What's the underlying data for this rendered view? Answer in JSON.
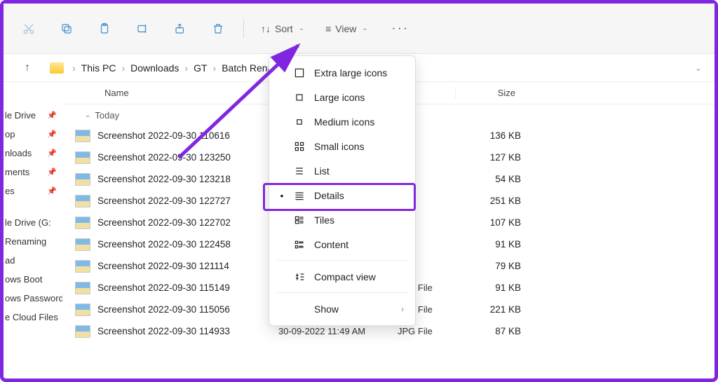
{
  "toolbar": {
    "sort_label": "Sort",
    "view_label": "View"
  },
  "breadcrumb": {
    "items": [
      "This PC",
      "Downloads",
      "GT",
      "Batch Renam"
    ]
  },
  "nav": {
    "items": [
      {
        "label": "le Drive",
        "pinned": true
      },
      {
        "label": "op",
        "pinned": true
      },
      {
        "label": "nloads",
        "pinned": true
      },
      {
        "label": "ments",
        "pinned": true
      },
      {
        "label": "es",
        "pinned": true
      }
    ],
    "items2": [
      {
        "label": "le Drive (G:"
      },
      {
        "label": "Renaming"
      },
      {
        "label": "ad"
      },
      {
        "label": "ows Boot"
      },
      {
        "label": "ows Password"
      },
      {
        "label": "e Cloud Files"
      }
    ]
  },
  "columns": {
    "name": "Name",
    "size": "Size"
  },
  "group_label": "Today",
  "files": [
    {
      "name": "Screenshot 2022-09-30 110616",
      "date": "",
      "type": "",
      "size": "136 KB"
    },
    {
      "name": "Screenshot 2022-09-30 123250",
      "date": "",
      "type": "",
      "size": "127 KB"
    },
    {
      "name": "Screenshot 2022-09-30 123218",
      "date": "",
      "type": "",
      "size": "54 KB"
    },
    {
      "name": "Screenshot 2022-09-30 122727",
      "date": "",
      "type": "",
      "size": "251 KB"
    },
    {
      "name": "Screenshot 2022-09-30 122702",
      "date": "",
      "type": "",
      "size": "107 KB"
    },
    {
      "name": "Screenshot 2022-09-30 122458",
      "date": "",
      "type": "",
      "size": "91 KB"
    },
    {
      "name": "Screenshot 2022-09-30 121114",
      "date": "",
      "type": "",
      "size": "79 KB"
    },
    {
      "name": "Screenshot 2022-09-30 115149",
      "date": "30-09-2022 11:51 AM",
      "type": "JPG File",
      "size": "91 KB"
    },
    {
      "name": "Screenshot 2022-09-30 115056",
      "date": "30-09-2022 11:50 AM",
      "type": "JPG File",
      "size": "221 KB"
    },
    {
      "name": "Screenshot 2022-09-30 114933",
      "date": "30-09-2022 11:49 AM",
      "type": "JPG File",
      "size": "87 KB"
    }
  ],
  "menu": {
    "items": [
      {
        "label": "Extra large icons",
        "icon": "square-lg",
        "selected": false
      },
      {
        "label": "Large icons",
        "icon": "square-md",
        "selected": false
      },
      {
        "label": "Medium icons",
        "icon": "square-sm",
        "selected": false
      },
      {
        "label": "Small icons",
        "icon": "grid",
        "selected": false
      },
      {
        "label": "List",
        "icon": "list",
        "selected": false
      },
      {
        "label": "Details",
        "icon": "details",
        "selected": true
      },
      {
        "label": "Tiles",
        "icon": "tiles",
        "selected": false
      },
      {
        "label": "Content",
        "icon": "content",
        "selected": false
      }
    ],
    "compact_label": "Compact view",
    "show_label": "Show"
  },
  "annotation": {
    "highlight": "Details"
  }
}
